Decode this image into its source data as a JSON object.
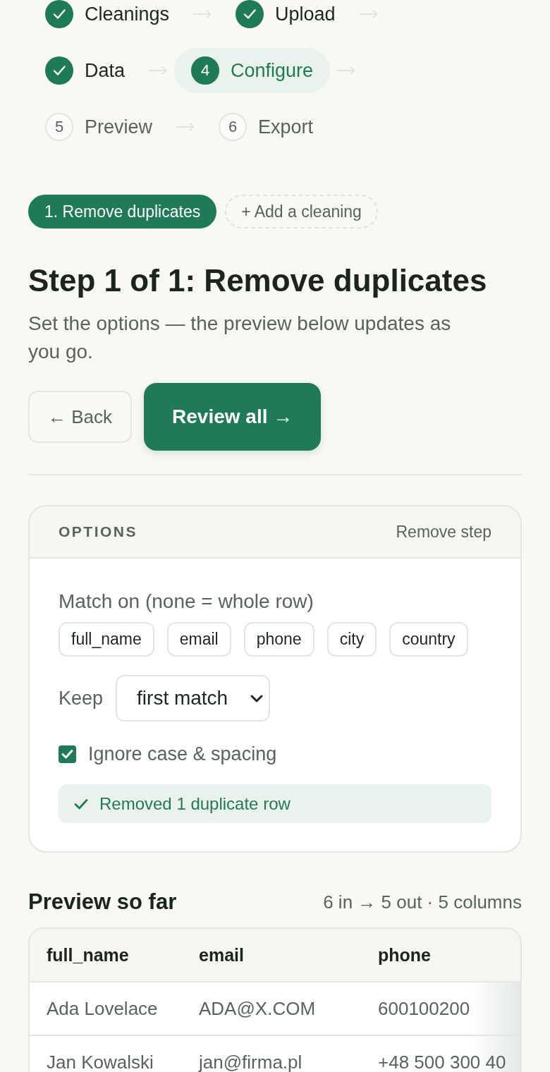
{
  "stepper": {
    "steps": [
      {
        "label": "Cleanings",
        "completed": true,
        "selected": false
      },
      {
        "label": "Upload",
        "completed": true,
        "selected": false
      },
      {
        "label": "Data",
        "completed": true,
        "selected": false
      },
      {
        "label": "Configure",
        "completed": false,
        "selected": true,
        "number": "4"
      },
      {
        "label": "Preview",
        "completed": false,
        "selected": false,
        "number": "5"
      },
      {
        "label": "Export",
        "completed": false,
        "selected": false,
        "number": "6"
      }
    ]
  },
  "cleanings": {
    "items": [
      {
        "label": "1. Remove duplicates",
        "selected": true
      }
    ],
    "add_button": "+ Add a cleaning"
  },
  "step_header": {
    "title": "Step 1 of 1: Remove duplicates",
    "subtitle": "Set the options — the preview below updates as you go."
  },
  "actions": {
    "back": "← Back",
    "primary": "Review all →"
  },
  "options": {
    "title": "OPTIONS",
    "remove_link": "Remove step",
    "match_on": {
      "label": "Match on (none = whole row)",
      "columns": [
        {
          "label": "full_name",
          "selected": false
        },
        {
          "label": "email",
          "selected": false
        },
        {
          "label": "phone",
          "selected": false
        },
        {
          "label": "city",
          "selected": false
        },
        {
          "label": "country",
          "selected": false
        }
      ]
    },
    "keep": {
      "label": "Keep",
      "value": "first match"
    },
    "ignore_case": {
      "label": "Ignore case & spacing",
      "checked": true
    },
    "notice": "Removed 1 duplicate row"
  },
  "preview": {
    "title": "Preview so far",
    "summary": "6 in → 5 out · 5 columns",
    "table": {
      "columns": [
        "full_name",
        "email",
        "phone"
      ],
      "rows": [
        [
          "Ada Lovelace",
          "ADA@X.COM",
          "600100200"
        ],
        [
          "Jan Kowalski",
          "jan@firma.pl",
          "+48 500 300 40"
        ]
      ]
    }
  }
}
